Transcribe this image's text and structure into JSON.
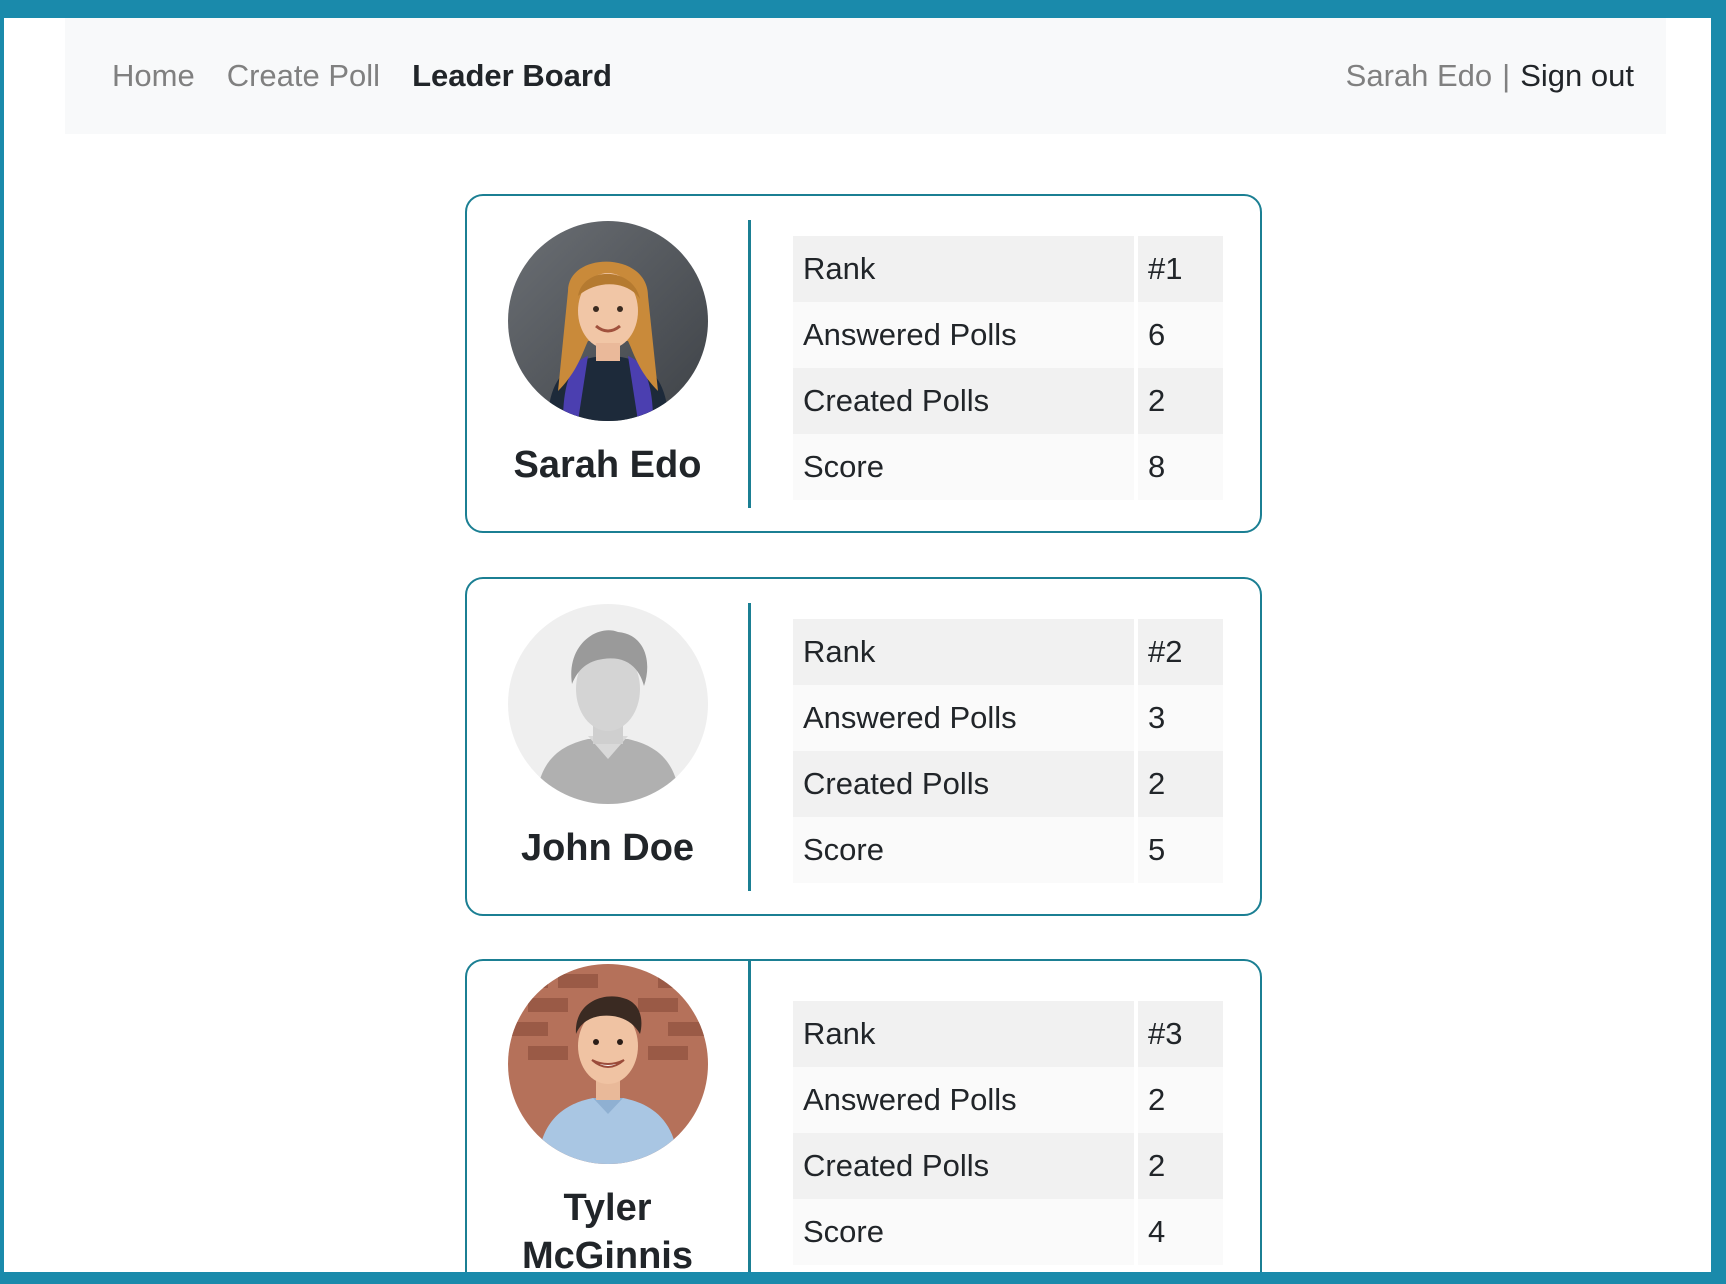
{
  "nav": {
    "links": [
      "Home",
      "Create Poll",
      "Leader Board"
    ],
    "active": "Leader Board",
    "user_name": "Sarah Edo",
    "separator": "|",
    "signout_label": "Sign out"
  },
  "colors": {
    "accent": "#1b7f93",
    "frame": "#1a8aab",
    "navbar_bg": "#f8f9fa"
  },
  "leaderboard": [
    {
      "name": "Sarah Edo",
      "avatar": "woman-photo-avatar",
      "rows": [
        {
          "label": "Rank",
          "value": "#1"
        },
        {
          "label": "Answered Polls",
          "value": "6"
        },
        {
          "label": "Created Polls",
          "value": "2"
        },
        {
          "label": "Score",
          "value": "8"
        }
      ]
    },
    {
      "name": "John Doe",
      "avatar": "default-person-avatar",
      "rows": [
        {
          "label": "Rank",
          "value": "#2"
        },
        {
          "label": "Answered Polls",
          "value": "3"
        },
        {
          "label": "Created Polls",
          "value": "2"
        },
        {
          "label": "Score",
          "value": "5"
        }
      ]
    },
    {
      "name": "Tyler McGinnis",
      "avatar": "man-photo-avatar",
      "rows": [
        {
          "label": "Rank",
          "value": "#3"
        },
        {
          "label": "Answered Polls",
          "value": "2"
        },
        {
          "label": "Created Polls",
          "value": "2"
        },
        {
          "label": "Score",
          "value": "4"
        }
      ]
    }
  ]
}
